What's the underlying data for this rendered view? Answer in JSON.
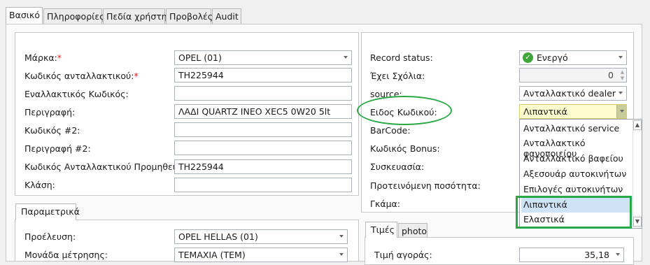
{
  "tabs": [
    "Βασικό",
    "Πληροφορίες",
    "Πεδία χρήστη",
    "Προβολές",
    "Audit"
  ],
  "left": {
    "marka_label": "Μάρκα:",
    "marka_value": "OPEL (01)",
    "kod_label": "Κωδικός ανταλλακτικού:",
    "kod_value": "TH225944",
    "enal_label": "Εναλλακτικός Κωδικός:",
    "enal_value": "",
    "perigrafi_label": "Περιγραφή:",
    "perigrafi_value": "ΛΑΔΙ QUARTZ INEO XEC5 0W20 5lt",
    "kod2_label": "Κωδικός #2:",
    "kod2_value": "",
    "per2_label": "Περιγραφή #2:",
    "per2_value": "",
    "prom_label": "Κωδικός Ανταλλακτικού Προμηθευτή:",
    "prom_value": "TH225944",
    "klasi_label": "Κλάση:",
    "klasi_value": "",
    "required_mark": "*"
  },
  "param": {
    "tab": "Παραμετρικά",
    "proeleusi_label": "Προέλευση:",
    "proeleusi_value": "OPEL HELLAS (01)",
    "monada_label": "Μονάδα μέτρησης:",
    "monada_value": "ΤΕΜΑΧΙΑ (TEM)"
  },
  "right": {
    "status_label": "Record status:",
    "status_value": "Ενεργό",
    "sxolia_label": "Έχει Σχόλια:",
    "sxolia_value": "0",
    "source_label": "source:",
    "source_value": "Ανταλλακτικό dealer",
    "eidos_label": "Ειδος Κωδικού:",
    "eidos_value": "Λιπαντικά",
    "barcode_label": "BarCode:",
    "bonus_label": "Κωδικός Bonus:",
    "syskevasia_label": "Συσκευασία:",
    "posotita_label": "Προτεινόμενη ποσότητα:",
    "gkama_label": "Γκάμα:"
  },
  "dropdown": {
    "options": [
      "Ανταλλακτικό service",
      "Ανταλλακτικό φανοποιείου",
      "Ανταλλακτικό βαφείου",
      "Αξεσουάρ αυτοκινήτων",
      "Επιλογές αυτοκινήτων",
      "Λιπαντικά",
      "Ελαστικά"
    ],
    "selected": "Λιπαντικά"
  },
  "prices": {
    "tabs": [
      "Τιμές",
      "photo"
    ],
    "timi_label": "Τιμή αγοράς:",
    "timi_value": "35,18"
  },
  "colors": {
    "highlight": "#2aa845",
    "required": "#e02020",
    "selected_bg": "#cfe3f7",
    "status_icon": "#3fa53a"
  }
}
